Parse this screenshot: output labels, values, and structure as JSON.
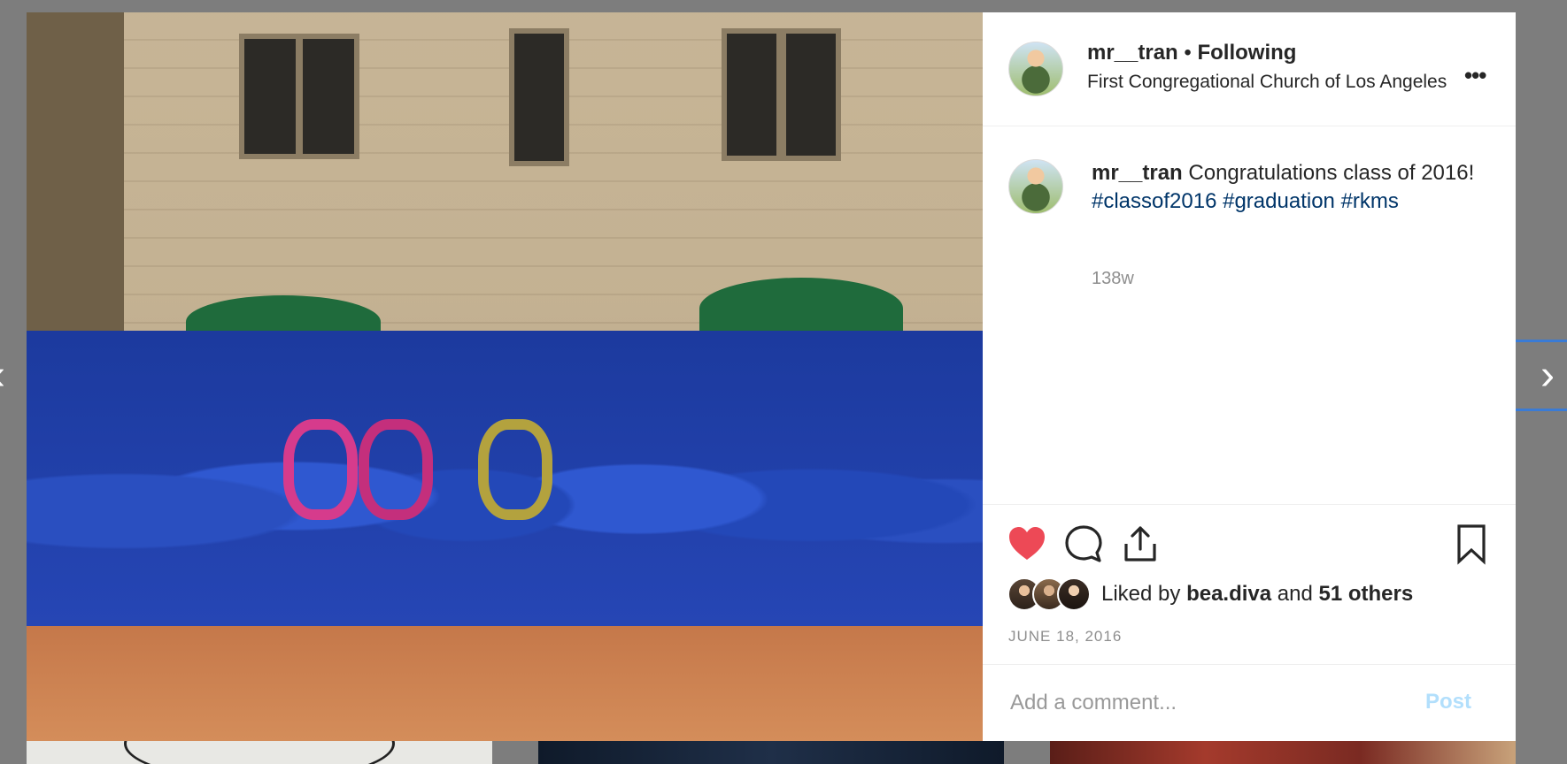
{
  "post": {
    "username": "mr__tran",
    "follow_separator": " • ",
    "follow_status": "Following",
    "location": "First Congregational Church of Los Angeles",
    "more_icon": "•••",
    "caption_username": "mr__tran",
    "caption_text": " Congratulations class of 2016! ",
    "hashtags": [
      "#classof2016",
      "#graduation",
      "#rkms"
    ],
    "time_ago": "138w",
    "likes_prefix": "Liked by ",
    "liked_by_user": "bea.diva",
    "likes_and": " and ",
    "likes_others": "51 others",
    "date": "JUNE 18, 2016",
    "comment_placeholder": "Add a comment...",
    "post_label": "Post"
  },
  "icons": {
    "like": "heart-icon",
    "comment": "comment-icon",
    "share": "share-icon",
    "save": "bookmark-icon",
    "nav_prev": "‹",
    "nav_next": "›"
  },
  "colors": {
    "like_active": "#ed4956",
    "hashtag": "#003569",
    "post_button_disabled": "#b2dffc",
    "secondary_text": "#8e8e8e"
  }
}
